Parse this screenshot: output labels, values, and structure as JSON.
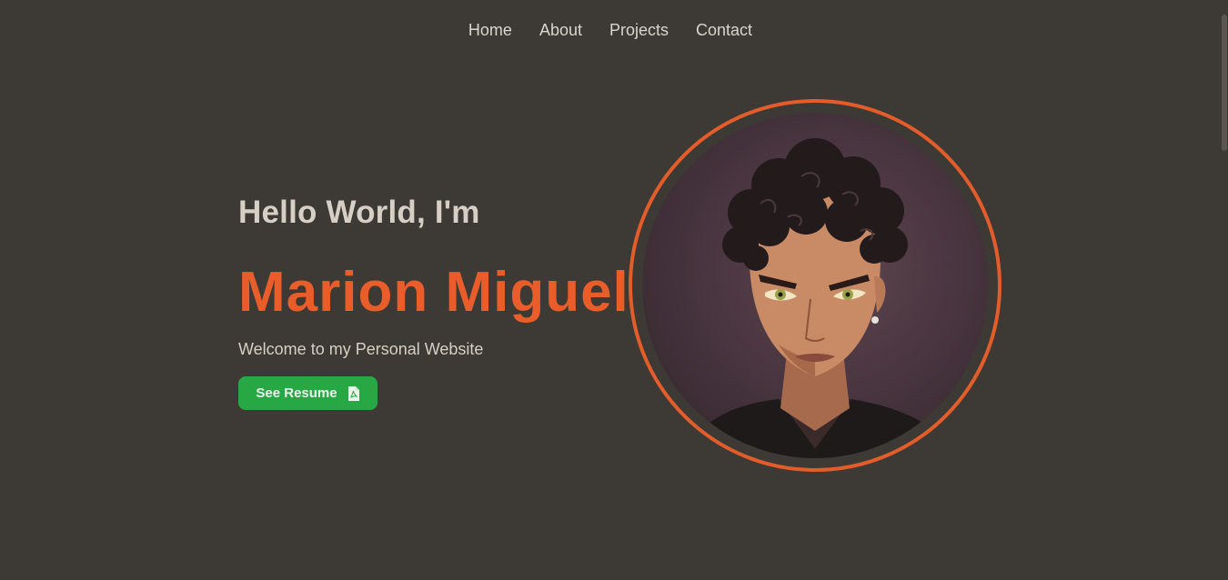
{
  "nav": {
    "items": [
      {
        "label": "Home"
      },
      {
        "label": "About"
      },
      {
        "label": "Projects"
      },
      {
        "label": "Contact"
      }
    ]
  },
  "hero": {
    "greeting": "Hello World, I'm",
    "name": "Marion Miguel",
    "tagline": "Welcome to my Personal Website",
    "resume_button_label": "See Resume",
    "resume_button_icon": "file-pdf-icon"
  },
  "colors": {
    "background": "#3d3935",
    "accent": "#e85d2a",
    "text": "#d6cfc6",
    "button": "#28a745"
  }
}
